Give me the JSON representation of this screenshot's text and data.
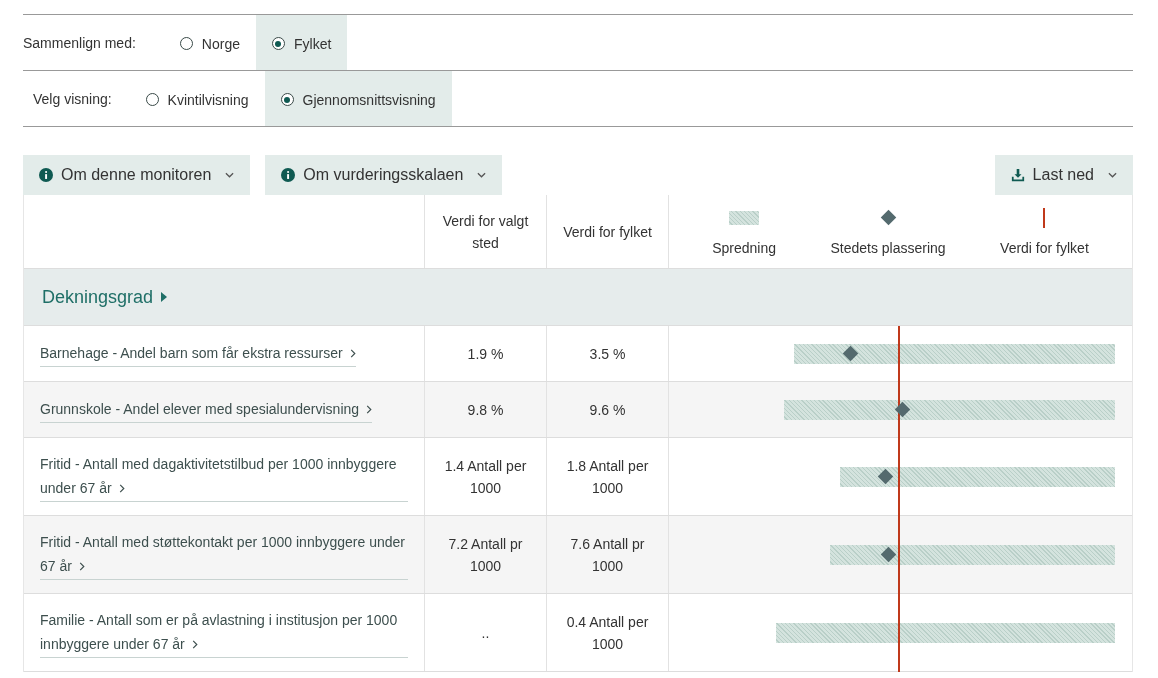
{
  "compare": {
    "label": "Sammenlign med:",
    "options": [
      {
        "label": "Norge",
        "selected": false
      },
      {
        "label": "Fylket",
        "selected": true
      }
    ]
  },
  "view": {
    "label": "Velg visning:",
    "options": [
      {
        "label": "Kvintilvisning",
        "selected": false
      },
      {
        "label": "Gjennomsnittsvisning",
        "selected": true
      }
    ]
  },
  "toolbar": {
    "buttons": [
      {
        "label": "Om denne monitoren"
      },
      {
        "label": "Om vurderingsskalaen"
      }
    ],
    "download": {
      "label": "Last ned"
    }
  },
  "table": {
    "columns": [
      "Verdi for valgt sted",
      "Verdi for fylket"
    ],
    "legend": [
      {
        "kind": "range",
        "label": "Spredning"
      },
      {
        "kind": "marker",
        "label": "Stedets plassering"
      },
      {
        "kind": "reference",
        "label": "Verdi for fylket"
      }
    ],
    "group": {
      "title": "Dekningsgrad",
      "rows": [
        {
          "label": "Barnehage - Andel barn som får ekstra ressurser",
          "value": "1.9 %",
          "county": "3.5 %"
        },
        {
          "label": "Grunnskole - Andel elever med spesialundervisning",
          "value": "9.8 %",
          "county": "9.6 %"
        },
        {
          "label": "Fritid - Antall med dagaktivitetstilbud per 1000 innbyggere under 67 år",
          "value": "1.4 Antall per 1000",
          "county": "1.8 Antall per 1000"
        },
        {
          "label": "Fritid - Antall med støttekontakt per 1000 innbyggere under 67 år",
          "value": "7.2 Antall pr 1000",
          "county": "7.6 Antall pr 1000"
        },
        {
          "label": "Familie - Antall som er på avlastning i institusjon per 1000 innbyggere under 67 år",
          "value": "..",
          "county": "0.4 Antall per 1000"
        }
      ]
    }
  }
}
